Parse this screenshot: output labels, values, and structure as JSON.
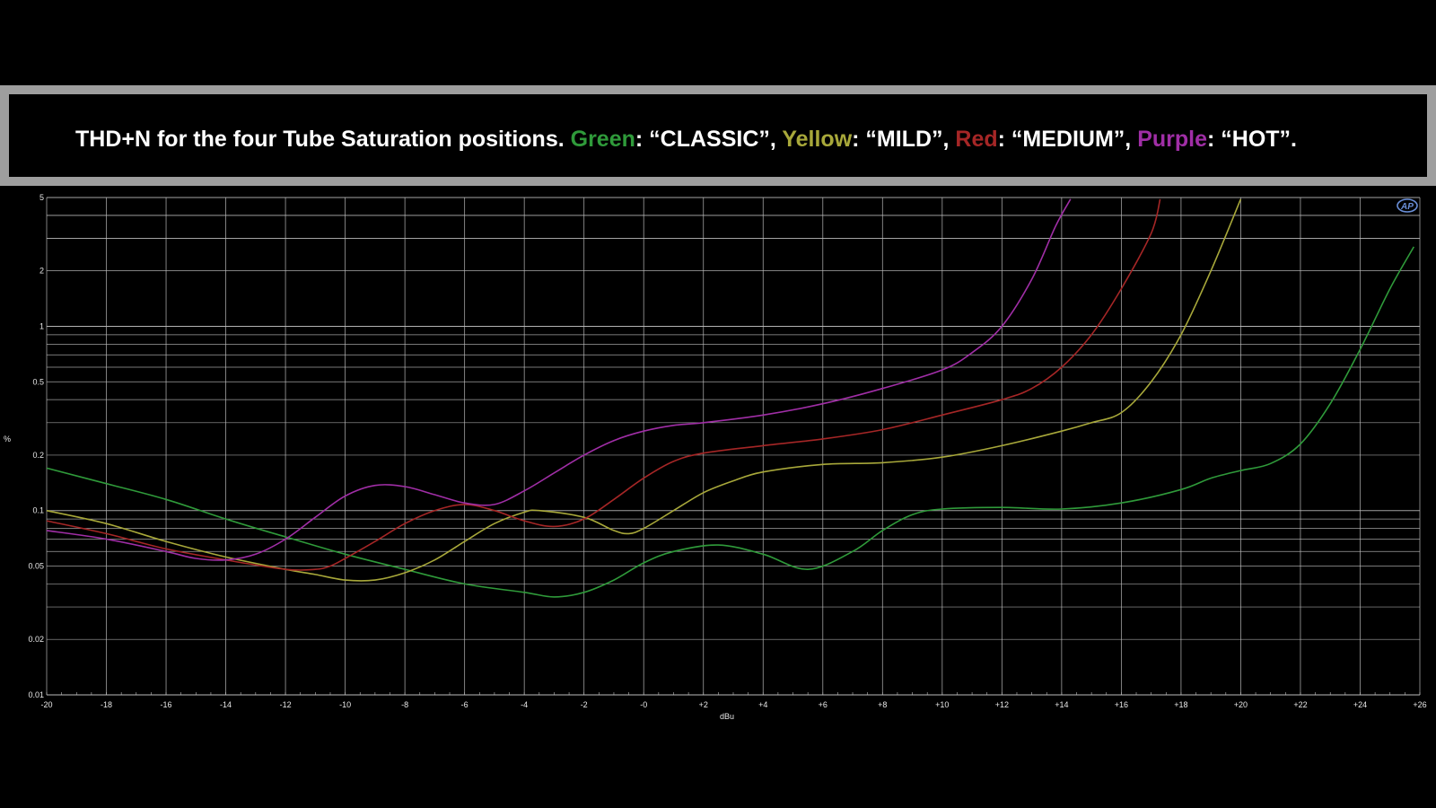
{
  "caption": {
    "lead": "THD+N for the four Tube Saturation positions. ",
    "green_word": "Green",
    "green_desc": ": “CLASSIC”, ",
    "yellow_word": "Yellow",
    "yellow_desc": ": “MILD”, ",
    "red_word": "Red",
    "red_desc": ": “MEDIUM”, ",
    "purple_word": "Purple",
    "purple_desc": ": “HOT”."
  },
  "colors": {
    "green": "#2f9a3a",
    "yellow": "#a8a83a",
    "red": "#a52626",
    "purple": "#a02ea6",
    "grid": "#bdbdbd",
    "background": "#000000"
  },
  "logo_icon": "ap-logo-icon",
  "chart_data": {
    "type": "line",
    "xlabel": "dBu",
    "ylabel": "%",
    "xlim": [
      -20,
      26
    ],
    "ylim": [
      0.01,
      5
    ],
    "yscale": "log",
    "grid": true,
    "xticks": [
      -20,
      -18,
      -16,
      -14,
      -12,
      -10,
      -8,
      -6,
      -4,
      -2,
      0,
      2,
      4,
      6,
      8,
      10,
      12,
      14,
      16,
      18,
      20,
      22,
      24,
      26
    ],
    "xtick_labels": [
      "-20",
      "-18",
      "-16",
      "-14",
      "-12",
      "-10",
      "-8",
      "-6",
      "-4",
      "-2",
      "-0",
      "+2",
      "+4",
      "+6",
      "+8",
      "+10",
      "+12",
      "+14",
      "+16",
      "+18",
      "+20",
      "+22",
      "+24",
      "+26"
    ],
    "yticks": [
      0.01,
      0.02,
      0.05,
      0.1,
      0.2,
      0.5,
      1,
      2,
      5
    ],
    "ytick_labels": [
      "0.01",
      "0.02",
      "0.05",
      "0.1",
      "0.2",
      "0.5",
      "1",
      "2",
      "5"
    ],
    "series": [
      {
        "colorKey": "green",
        "points": [
          [
            -20,
            0.17
          ],
          [
            -18,
            0.14
          ],
          [
            -16,
            0.115
          ],
          [
            -14,
            0.09
          ],
          [
            -12,
            0.072
          ],
          [
            -10,
            0.058
          ],
          [
            -8,
            0.048
          ],
          [
            -6,
            0.04
          ],
          [
            -4,
            0.036
          ],
          [
            -3,
            0.034
          ],
          [
            -2,
            0.036
          ],
          [
            -1,
            0.042
          ],
          [
            0,
            0.052
          ],
          [
            1,
            0.06
          ],
          [
            2.5,
            0.065
          ],
          [
            4,
            0.058
          ],
          [
            5.5,
            0.048
          ],
          [
            7,
            0.06
          ],
          [
            8,
            0.078
          ],
          [
            9,
            0.095
          ],
          [
            10,
            0.102
          ],
          [
            12,
            0.104
          ],
          [
            14,
            0.102
          ],
          [
            16,
            0.11
          ],
          [
            18,
            0.13
          ],
          [
            19,
            0.15
          ],
          [
            20,
            0.165
          ],
          [
            21,
            0.18
          ],
          [
            22,
            0.23
          ],
          [
            23,
            0.38
          ],
          [
            24,
            0.75
          ],
          [
            25,
            1.6
          ],
          [
            25.8,
            2.7
          ]
        ]
      },
      {
        "colorKey": "yellow",
        "points": [
          [
            -20,
            0.1
          ],
          [
            -18,
            0.085
          ],
          [
            -16,
            0.068
          ],
          [
            -14,
            0.056
          ],
          [
            -12,
            0.048
          ],
          [
            -11,
            0.045
          ],
          [
            -10,
            0.042
          ],
          [
            -9,
            0.042
          ],
          [
            -8,
            0.046
          ],
          [
            -7,
            0.054
          ],
          [
            -6,
            0.068
          ],
          [
            -5,
            0.085
          ],
          [
            -4,
            0.098
          ],
          [
            -3.5,
            0.1
          ],
          [
            -2,
            0.092
          ],
          [
            -1,
            0.078
          ],
          [
            -0.5,
            0.075
          ],
          [
            0,
            0.08
          ],
          [
            1,
            0.1
          ],
          [
            2,
            0.125
          ],
          [
            3,
            0.145
          ],
          [
            4,
            0.162
          ],
          [
            6,
            0.178
          ],
          [
            8,
            0.182
          ],
          [
            10,
            0.195
          ],
          [
            12,
            0.225
          ],
          [
            14,
            0.27
          ],
          [
            15,
            0.3
          ],
          [
            16,
            0.34
          ],
          [
            17,
            0.5
          ],
          [
            18,
            0.9
          ],
          [
            19,
            2.0
          ],
          [
            20,
            4.9
          ]
        ]
      },
      {
        "colorKey": "red",
        "points": [
          [
            -20,
            0.088
          ],
          [
            -18,
            0.075
          ],
          [
            -16,
            0.062
          ],
          [
            -14,
            0.054
          ],
          [
            -12,
            0.048
          ],
          [
            -11,
            0.048
          ],
          [
            -10.5,
            0.05
          ],
          [
            -10,
            0.055
          ],
          [
            -9,
            0.068
          ],
          [
            -8,
            0.085
          ],
          [
            -7,
            0.1
          ],
          [
            -6,
            0.108
          ],
          [
            -5,
            0.1
          ],
          [
            -4,
            0.088
          ],
          [
            -3,
            0.082
          ],
          [
            -2,
            0.09
          ],
          [
            -1,
            0.115
          ],
          [
            0,
            0.15
          ],
          [
            1,
            0.185
          ],
          [
            2,
            0.205
          ],
          [
            4,
            0.225
          ],
          [
            6,
            0.245
          ],
          [
            8,
            0.275
          ],
          [
            10,
            0.33
          ],
          [
            12,
            0.4
          ],
          [
            13,
            0.46
          ],
          [
            14,
            0.6
          ],
          [
            15,
            0.9
          ],
          [
            16,
            1.6
          ],
          [
            17,
            3.2
          ],
          [
            17.3,
            4.9
          ]
        ]
      },
      {
        "colorKey": "purple",
        "points": [
          [
            -20,
            0.078
          ],
          [
            -18,
            0.07
          ],
          [
            -16,
            0.06
          ],
          [
            -15,
            0.055
          ],
          [
            -14,
            0.054
          ],
          [
            -13,
            0.058
          ],
          [
            -12,
            0.07
          ],
          [
            -11,
            0.092
          ],
          [
            -10,
            0.12
          ],
          [
            -9,
            0.137
          ],
          [
            -8,
            0.135
          ],
          [
            -7,
            0.122
          ],
          [
            -6,
            0.11
          ],
          [
            -5,
            0.108
          ],
          [
            -4,
            0.128
          ],
          [
            -3,
            0.16
          ],
          [
            -2,
            0.2
          ],
          [
            -1,
            0.24
          ],
          [
            0,
            0.27
          ],
          [
            1,
            0.29
          ],
          [
            2,
            0.3
          ],
          [
            4,
            0.33
          ],
          [
            6,
            0.38
          ],
          [
            8,
            0.46
          ],
          [
            10,
            0.58
          ],
          [
            11,
            0.72
          ],
          [
            12,
            1.0
          ],
          [
            13,
            1.8
          ],
          [
            13.8,
            3.5
          ],
          [
            14.3,
            4.9
          ]
        ]
      }
    ]
  }
}
